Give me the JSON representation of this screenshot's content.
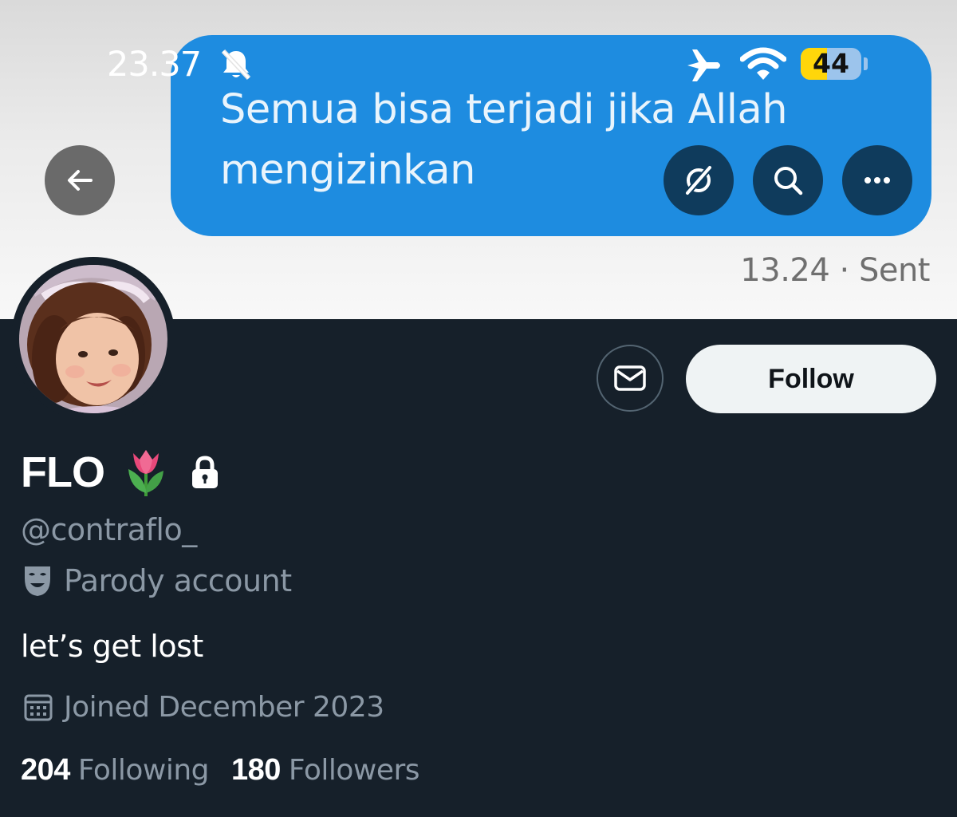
{
  "status_bar": {
    "time": "23.37",
    "battery": "44",
    "battery_level_percent": 44,
    "icons": [
      "bell-slash-icon",
      "airplane-icon",
      "wifi-icon",
      "battery-icon"
    ]
  },
  "banner": {
    "message": "Semua bisa terjadi jika Allah mengizinkan",
    "sent_info": "13.24 · Sent",
    "bubble_color": "#1e8ce0"
  },
  "header_actions": {
    "icons": [
      "back-arrow-icon",
      "grok-icon",
      "search-icon",
      "more-icon"
    ]
  },
  "profile": {
    "display_name": "FLO",
    "name_emoji": "🌷",
    "handle": "@contraflo_",
    "parody_label": "Parody account",
    "bio": "let’s get lost",
    "joined": "Joined December 2023",
    "following_count": "204",
    "following_label": "Following",
    "followers_count": "180",
    "followers_label": "Followers",
    "follow_button": "Follow",
    "icons": [
      "lock-icon",
      "theater-mask-icon",
      "calendar-icon",
      "mail-icon"
    ]
  },
  "colors": {
    "background": "#16202a",
    "muted_text": "#8b98a5",
    "follow_button_bg": "#eff3f4"
  }
}
